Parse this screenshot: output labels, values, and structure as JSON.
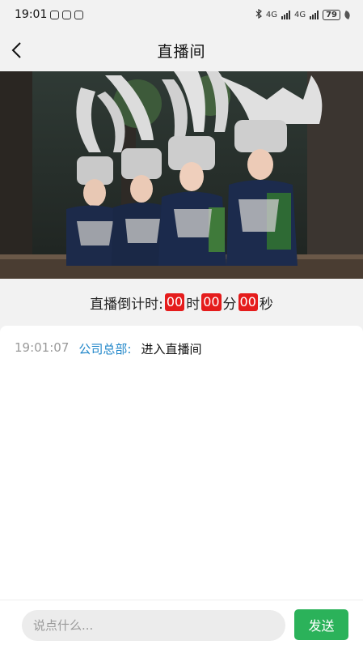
{
  "status_bar": {
    "time": "19:01",
    "network": "4G",
    "network2": "4G",
    "battery": "79"
  },
  "nav": {
    "title": "直播间",
    "back_icon": "chevron-left-icon"
  },
  "video": {
    "description_icon": "live-video-frame"
  },
  "countdown": {
    "label": "直播倒计时:",
    "hours": "00",
    "hours_unit": "时",
    "minutes": "00",
    "minutes_unit": "分",
    "seconds": "00",
    "seconds_unit": "秒",
    "highlight_color": "#e51c1c"
  },
  "chat": {
    "messages": [
      {
        "time": "19:01:07",
        "user": "公司总部:",
        "text": "进入直播间"
      }
    ],
    "user_color": "#1f86c9"
  },
  "input": {
    "placeholder": "说点什么...",
    "send_label": "发送",
    "send_color": "#2bb25a"
  }
}
